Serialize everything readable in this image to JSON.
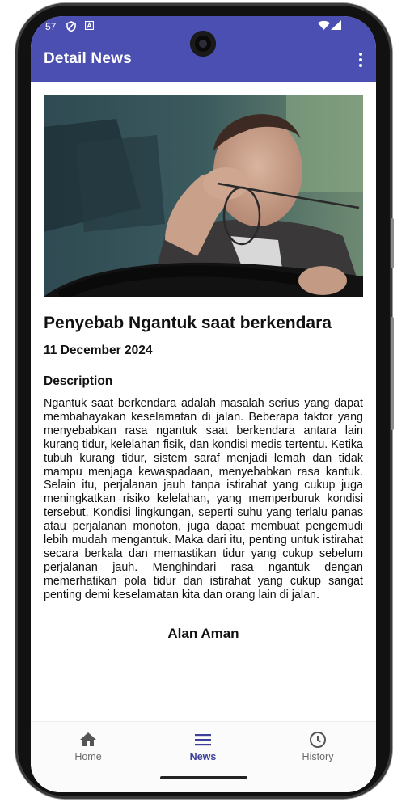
{
  "status_bar": {
    "time": "57"
  },
  "app_bar": {
    "title": "Detail News",
    "menu_icon": "more-vert-icon"
  },
  "article": {
    "image_alt": "Man rubbing his eyes while driving",
    "title": "Penyebab Ngantuk saat berkendara",
    "date": "11 December 2024",
    "description_heading": "Description",
    "description": "Ngantuk saat berkendara adalah masalah serius yang dapat membahayakan keselamatan di jalan. Beberapa faktor yang menyebabkan rasa ngantuk saat berkendara antara lain kurang tidur, kelelahan fisik, dan kondisi medis tertentu. Ketika tubuh kurang tidur, sistem saraf menjadi lemah dan tidak mampu menjaga kewaspadaan, menyebabkan rasa kantuk. Selain itu, perjalanan jauh tanpa istirahat yang cukup juga meningkatkan risiko kelelahan, yang memperburuk kondisi tersebut. Kondisi lingkungan, seperti suhu yang terlalu panas atau perjalanan monoton, juga dapat membuat pengemudi lebih mudah mengantuk. Maka dari itu, penting untuk istirahat secara berkala dan memastikan tidur yang cukup sebelum perjalanan jauh. Menghindari rasa ngantuk dengan memerhatikan pola tidur dan istirahat yang cukup sangat penting demi keselamatan kita dan orang lain di jalan.",
    "author": "Alan Aman"
  },
  "bottom_nav": {
    "items": [
      {
        "label": "Home",
        "icon": "home-icon",
        "active": false
      },
      {
        "label": "News",
        "icon": "news-icon",
        "active": true
      },
      {
        "label": "History",
        "icon": "history-icon",
        "active": false
      }
    ]
  },
  "colors": {
    "primary": "#4b4fb2",
    "active_nav": "#3d419c",
    "inactive_nav": "#6b6b6b"
  }
}
